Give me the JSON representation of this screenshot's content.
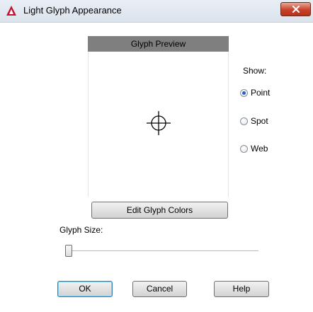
{
  "window": {
    "title": "Light Glyph Appearance",
    "app_icon": "autocad-a-icon",
    "close_icon": "close-x-icon",
    "accent_color": "#c7412b"
  },
  "preview": {
    "header": "Glyph Preview",
    "glyph_icon": "crosshair-point-glyph"
  },
  "show": {
    "label": "Show:",
    "options": [
      {
        "label": "Point",
        "checked": true
      },
      {
        "label": "Spot",
        "checked": false
      },
      {
        "label": "Web",
        "checked": false
      }
    ]
  },
  "edit_colors_label": "Edit Glyph Colors",
  "glyph_size": {
    "label": "Glyph Size:",
    "level": 0.0
  },
  "buttons": {
    "ok": "OK",
    "cancel": "Cancel",
    "help": "Help"
  }
}
